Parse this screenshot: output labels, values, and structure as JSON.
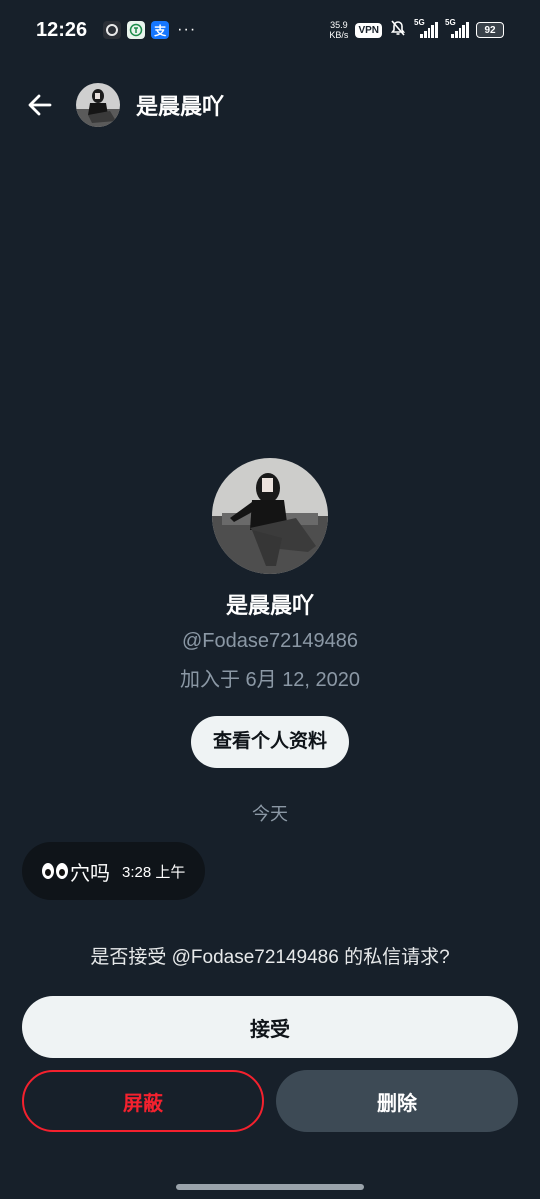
{
  "status_bar": {
    "time": "12:26",
    "net_speed_value": "35.9",
    "net_speed_unit": "KB/s",
    "vpn": "VPN",
    "signal1": "5G",
    "signal2": "5G",
    "battery": "92",
    "more": "···",
    "apps": [
      "camera-icon",
      "green-app-icon",
      "alipay-icon"
    ],
    "alipay_glyph": "支"
  },
  "header": {
    "title": "是晨晨吖"
  },
  "profile": {
    "name": "是晨晨吖",
    "handle": "@Fodase72149486",
    "joined": "加入于 6月 12, 2020",
    "view_profile_label": "查看个人资料"
  },
  "conversation": {
    "date_divider": "今天",
    "messages": [
      {
        "text": "穴吗",
        "time": "3:28 上午",
        "emoji": "eyes"
      }
    ]
  },
  "request": {
    "prompt": "是否接受 @Fodase72149486 的私信请求?",
    "accept_label": "接受",
    "block_label": "屏蔽",
    "delete_label": "删除"
  },
  "colors": {
    "background": "#17202a",
    "accent_danger": "#f4212e",
    "secondary_text": "#8b98a5"
  }
}
